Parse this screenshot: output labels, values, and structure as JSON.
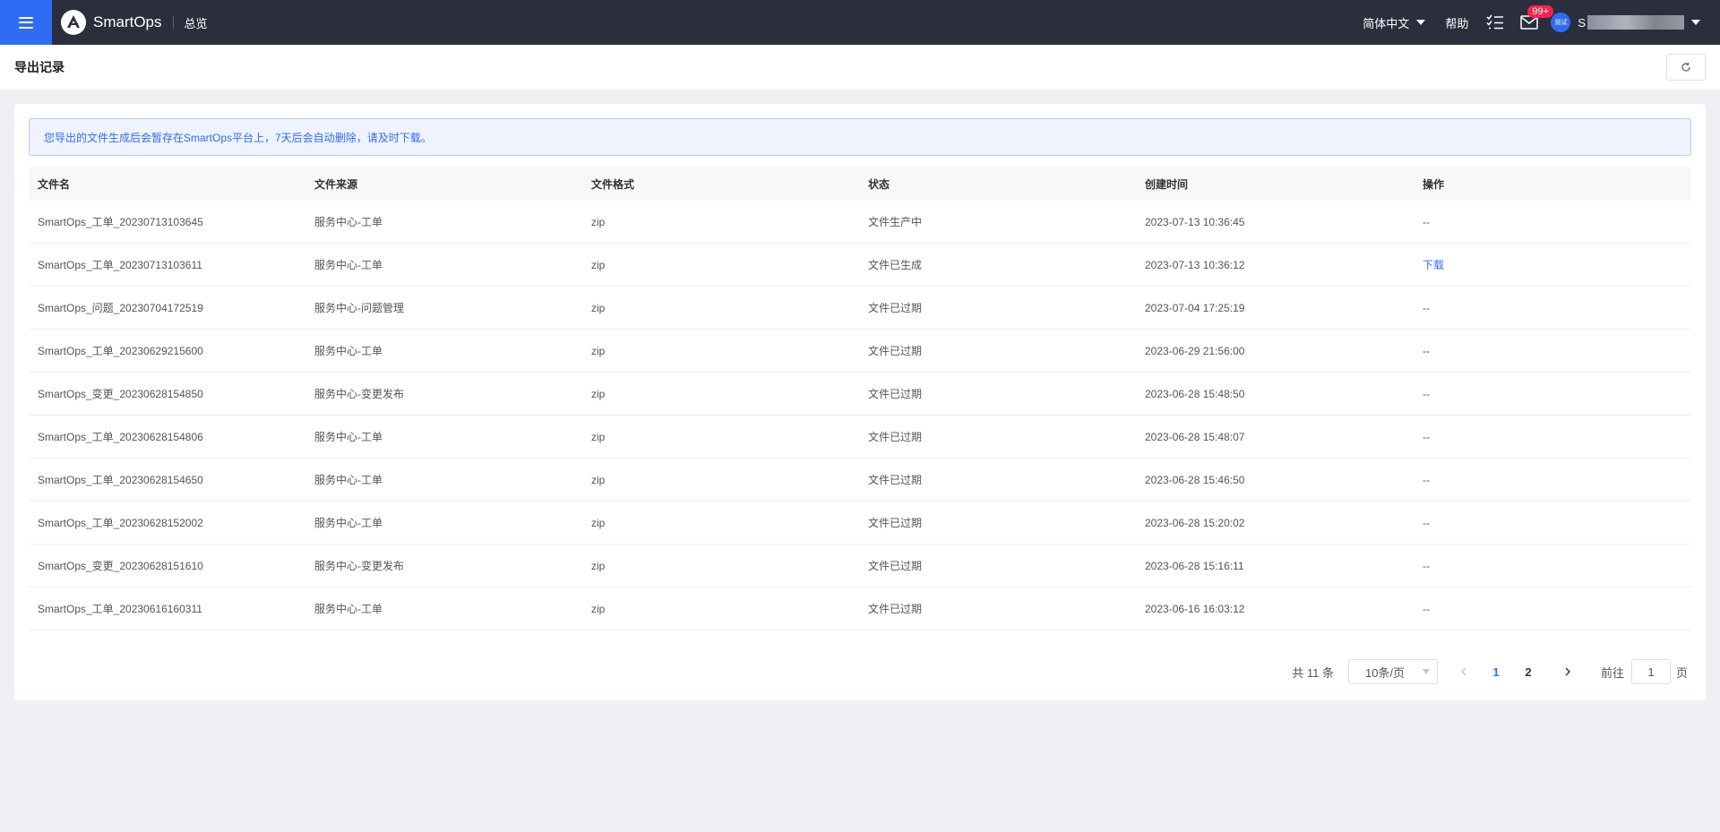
{
  "topbar": {
    "app_name": "SmartOps",
    "nav_overview": "总览",
    "language": "简体中文",
    "help": "帮助",
    "mail_badge": "99+",
    "avatar_text": "测试",
    "user_name": "S"
  },
  "page": {
    "title": "导出记录"
  },
  "notice": "您导出的文件生成后会暂存在SmartOps平台上，7天后会自动删除，请及时下载。",
  "table": {
    "headers": [
      "文件名",
      "文件来源",
      "文件格式",
      "状态",
      "创建时间",
      "操作"
    ],
    "rows": [
      {
        "name": "SmartOps_工单_20230713103645",
        "source": "服务中心-工单",
        "format": "zip",
        "status": "文件生产中",
        "created": "2023-07-13 10:36:45",
        "op": "--"
      },
      {
        "name": "SmartOps_工单_20230713103611",
        "source": "服务中心-工单",
        "format": "zip",
        "status": "文件已生成",
        "created": "2023-07-13 10:36:12",
        "op": "下载"
      },
      {
        "name": "SmartOps_问题_20230704172519",
        "source": "服务中心-问题管理",
        "format": "zip",
        "status": "文件已过期",
        "created": "2023-07-04 17:25:19",
        "op": "--"
      },
      {
        "name": "SmartOps_工单_20230629215600",
        "source": "服务中心-工单",
        "format": "zip",
        "status": "文件已过期",
        "created": "2023-06-29 21:56:00",
        "op": "--"
      },
      {
        "name": "SmartOps_变更_20230628154850",
        "source": "服务中心-变更发布",
        "format": "zip",
        "status": "文件已过期",
        "created": "2023-06-28 15:48:50",
        "op": "--"
      },
      {
        "name": "SmartOps_工单_20230628154806",
        "source": "服务中心-工单",
        "format": "zip",
        "status": "文件已过期",
        "created": "2023-06-28 15:48:07",
        "op": "--"
      },
      {
        "name": "SmartOps_工单_20230628154650",
        "source": "服务中心-工单",
        "format": "zip",
        "status": "文件已过期",
        "created": "2023-06-28 15:46:50",
        "op": "--"
      },
      {
        "name": "SmartOps_工单_20230628152002",
        "source": "服务中心-工单",
        "format": "zip",
        "status": "文件已过期",
        "created": "2023-06-28 15:20:02",
        "op": "--"
      },
      {
        "name": "SmartOps_变更_20230628151610",
        "source": "服务中心-变更发布",
        "format": "zip",
        "status": "文件已过期",
        "created": "2023-06-28 15:16:11",
        "op": "--"
      },
      {
        "name": "SmartOps_工单_20230616160311",
        "source": "服务中心-工单",
        "format": "zip",
        "status": "文件已过期",
        "created": "2023-06-16 16:03:12",
        "op": "--"
      }
    ]
  },
  "pagination": {
    "total_text": "共 11 条",
    "page_size": "10条/页",
    "pages": [
      "1",
      "2"
    ],
    "current_page": "1",
    "goto_label": "前往",
    "goto_value": "1",
    "page_suffix": "页"
  },
  "colors": {
    "topbar": "#2b2f3d",
    "accent": "#2f6cf6",
    "badge": "#f5224d",
    "background": "#eef0f4"
  },
  "icons": [
    "menu-icon",
    "smartops-logo-icon",
    "caret-down-icon",
    "todo-list-icon",
    "mail-icon",
    "refresh-icon",
    "chevron-left-icon",
    "chevron-right-icon"
  ]
}
